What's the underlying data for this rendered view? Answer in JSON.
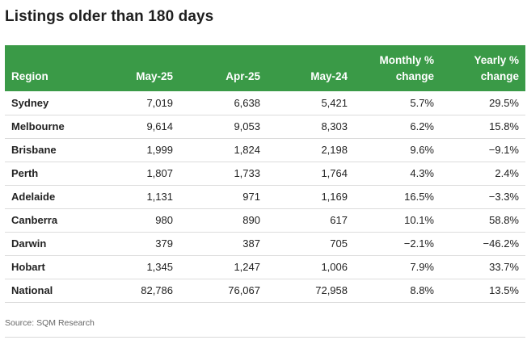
{
  "title": "Listings older than 180 days",
  "source": "Source: SQM Research",
  "chart_data": {
    "type": "table",
    "title": "Listings older than 180 days",
    "columns": [
      "Region",
      "May-25",
      "Apr-25",
      "May-24",
      "Monthly % change",
      "Yearly % change"
    ],
    "column_lines": [
      [
        null,
        "Region"
      ],
      [
        null,
        "May-25"
      ],
      [
        null,
        "Apr-25"
      ],
      [
        null,
        "May-24"
      ],
      [
        "Monthly %",
        "change"
      ],
      [
        "Yearly %",
        "change"
      ]
    ],
    "rows": [
      [
        "Sydney",
        "7,019",
        "6,638",
        "5,421",
        "5.7%",
        "29.5%"
      ],
      [
        "Melbourne",
        "9,614",
        "9,053",
        "8,303",
        "6.2%",
        "15.8%"
      ],
      [
        "Brisbane",
        "1,999",
        "1,824",
        "2,198",
        "9.6%",
        "−9.1%"
      ],
      [
        "Perth",
        "1,807",
        "1,733",
        "1,764",
        "4.3%",
        "2.4%"
      ],
      [
        "Adelaide",
        "1,131",
        "971",
        "1,169",
        "16.5%",
        "−3.3%"
      ],
      [
        "Canberra",
        "980",
        "890",
        "617",
        "10.1%",
        "58.8%"
      ],
      [
        "Darwin",
        "379",
        "387",
        "705",
        "−2.1%",
        "−46.2%"
      ],
      [
        "Hobart",
        "1,345",
        "1,247",
        "1,006",
        "7.9%",
        "33.7%"
      ],
      [
        "National",
        "82,786",
        "76,067",
        "72,958",
        "8.8%",
        "13.5%"
      ]
    ]
  },
  "colors": {
    "header_bg": "#3a9a47",
    "header_text": "#ffffff",
    "row_divider": "#dcdcdc"
  }
}
